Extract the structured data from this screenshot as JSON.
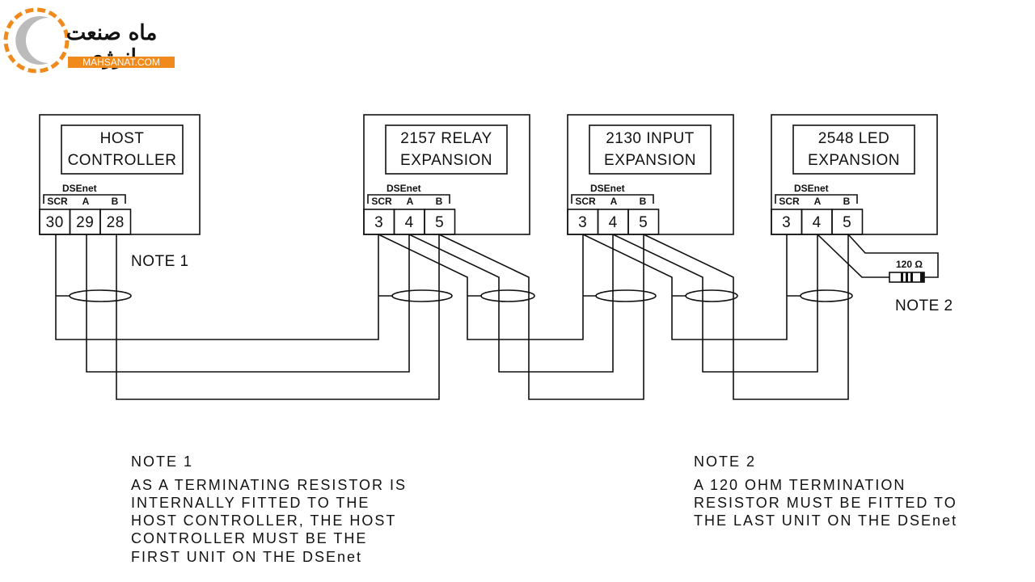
{
  "logo": {
    "persian_text": "ماه صنعت انرژی",
    "site": "MAHSANAT.COM",
    "accent": "#f08a1c"
  },
  "modules": [
    {
      "title1": "HOST",
      "title2": "CONTROLLER",
      "bus": "DSEnet",
      "labels": [
        "SCR",
        "A",
        "B"
      ],
      "terminals": [
        "30",
        "29",
        "28"
      ]
    },
    {
      "title1": "2157 RELAY",
      "title2": "EXPANSION",
      "bus": "DSEnet",
      "labels": [
        "SCR",
        "A",
        "B"
      ],
      "terminals": [
        "3",
        "4",
        "5"
      ]
    },
    {
      "title1": "2130 INPUT",
      "title2": "EXPANSION",
      "bus": "DSEnet",
      "labels": [
        "SCR",
        "A",
        "B"
      ],
      "terminals": [
        "3",
        "4",
        "5"
      ]
    },
    {
      "title1": "2548 LED",
      "title2": "EXPANSION",
      "bus": "DSEnet",
      "labels": [
        "SCR",
        "A",
        "B"
      ],
      "terminals": [
        "3",
        "4",
        "5"
      ]
    }
  ],
  "note1_marker": "NOTE 1",
  "note2_marker": "NOTE 2",
  "resistor_label": "120 Ω",
  "note1": {
    "title": "NOTE 1",
    "lines": [
      "AS A TERMINATING RESISTOR IS",
      "INTERNALLY FITTED TO THE",
      "HOST CONTROLLER, THE HOST",
      "CONTROLLER MUST BE THE",
      "FIRST UNIT ON THE DSEnet"
    ]
  },
  "note2": {
    "title": "NOTE 2",
    "lines": [
      "A 120 OHM TERMINATION",
      "RESISTOR MUST BE FITTED TO",
      "THE LAST UNIT ON THE DSEnet"
    ]
  }
}
